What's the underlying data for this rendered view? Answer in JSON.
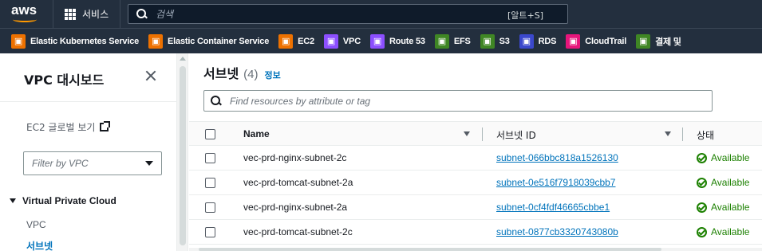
{
  "topnav": {
    "logo_text": "aws",
    "services_label": "서비스",
    "search_placeholder": "검색",
    "search_shortcut": "[알트+S]"
  },
  "favorites": [
    {
      "label": "Elastic Kubernetes Service",
      "icon": "eks-icon",
      "color": "#ed7100"
    },
    {
      "label": "Elastic Container Service",
      "icon": "ecs-icon",
      "color": "#ed7100"
    },
    {
      "label": "EC2",
      "icon": "ec2-icon",
      "color": "#ed7100"
    },
    {
      "label": "VPC",
      "icon": "vpc-icon",
      "color": "#8c4fff"
    },
    {
      "label": "Route 53",
      "icon": "route53-icon",
      "color": "#8c4fff"
    },
    {
      "label": "EFS",
      "icon": "efs-icon",
      "color": "#3f8624"
    },
    {
      "label": "S3",
      "icon": "s3-icon",
      "color": "#3f8624"
    },
    {
      "label": "RDS",
      "icon": "rds-icon",
      "color": "#3b48cc"
    },
    {
      "label": "CloudTrail",
      "icon": "cloudtrail-icon",
      "color": "#e7157b"
    },
    {
      "label": "결제 및",
      "icon": "billing-icon",
      "color": "#3f8624"
    }
  ],
  "sidebar": {
    "title": "VPC 대시보드",
    "ec2_global_view": "EC2 글로벌 보기",
    "filter_placeholder": "Filter by VPC",
    "section_title": "Virtual Private Cloud",
    "links": [
      {
        "label": "VPC",
        "active": false
      },
      {
        "label": "서브넷",
        "active": true
      }
    ]
  },
  "main": {
    "title": "서브넷",
    "count": "(4)",
    "info_link": "정보",
    "filter_placeholder": "Find resources by attribute or tag",
    "columns": {
      "name": "Name",
      "subnet_id": "서브넷 ID",
      "state": "상태"
    },
    "rows": [
      {
        "name": "vec-prd-nginx-subnet-2c",
        "subnet_id": "subnet-066bbc818a1526130",
        "state": "Available"
      },
      {
        "name": "vec-prd-tomcat-subnet-2a",
        "subnet_id": "subnet-0e516f7918039cbb7",
        "state": "Available"
      },
      {
        "name": "vec-prd-nginx-subnet-2a",
        "subnet_id": "subnet-0cf4fdf46665cbbe1",
        "state": "Available"
      },
      {
        "name": "vec-prd-tomcat-subnet-2c",
        "subnet_id": "subnet-0877cb3320743080b",
        "state": "Available"
      }
    ]
  },
  "colors": {
    "nav_bg": "#232f3e",
    "link": "#0073bb",
    "success": "#1d8102"
  }
}
